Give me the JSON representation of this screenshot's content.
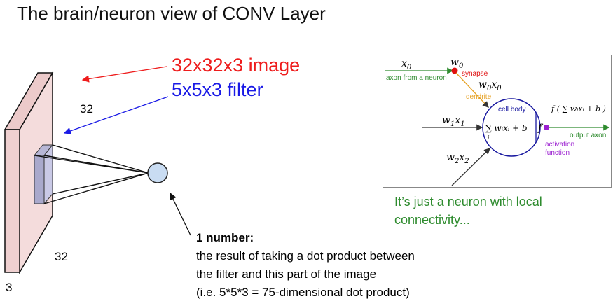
{
  "title": "The brain/neuron view of CONV Layer",
  "labels": {
    "image": "32x32x3 image",
    "filter": "5x5x3 filter",
    "width_dim": "32",
    "height_dim": "32",
    "depth_dim": "3"
  },
  "annotation": {
    "heading": "1 number:",
    "lines": [
      "the result of taking a dot product between",
      "the filter and this part of the image",
      "(i.e. 5*5*3 = 75-dimensional dot product)"
    ]
  },
  "caption": {
    "line1": "It’s just a neuron with local",
    "line2": "connectivity..."
  },
  "neuron": {
    "x0": "x",
    "x0_sub": "0",
    "w0": "w",
    "w0_sub": "0",
    "synapse": "synapse",
    "axon_from": "axon from a neuron",
    "w0x0": "w",
    "w0x0_sub_a": "0",
    "w0x0_x": "x",
    "w0x0_sub_b": "0",
    "dendrite": "dendrite",
    "cell_body": "cell body",
    "w1x1": "w",
    "w1x1_sub_a": "1",
    "w1x1_x": "x",
    "w1x1_sub_b": "1",
    "w2x2": "w",
    "w2x2_sub_a": "2",
    "w2x2_x": "x",
    "w2x2_sub_b": "2",
    "sum_expr": "∑ wᵢxᵢ + b",
    "sum_index": "i",
    "f_label": "f",
    "output_expr": "f ( ∑ wᵢxᵢ + b )",
    "output_axon": "output axon",
    "activation_line1": "activation",
    "activation_line2": "function"
  },
  "colors": {
    "image_label": "#ee1c1c",
    "filter_label": "#1a1ae6",
    "caption": "#2e8b2e",
    "slab_face": "#f4dcdc",
    "neuron_fill": "#c9dcf2",
    "synapse": "#e01010",
    "axon": "#2e8b2e",
    "dendrite": "#e6a020",
    "activation": "#9b1fd0",
    "cell_body": "#1a1aa0"
  }
}
